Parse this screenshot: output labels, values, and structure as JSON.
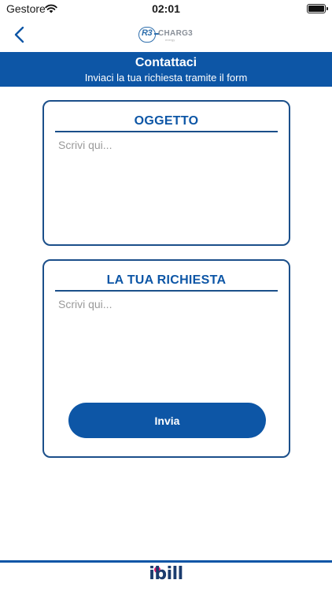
{
  "status_bar": {
    "carrier": "Gestore",
    "time": "02:01"
  },
  "nav": {
    "logo_mark": "R3",
    "logo_word": "CHARG3",
    "logo_sub": "energy"
  },
  "header": {
    "title": "Contattaci",
    "subtitle": "Inviaci la tua richiesta tramite il form"
  },
  "form": {
    "subject": {
      "title": "OGGETTO",
      "placeholder": "Scrivi qui...",
      "value": ""
    },
    "request": {
      "title": "LA TUA RICHIESTA",
      "placeholder": "Scrivi qui...",
      "value": ""
    },
    "send_label": "Invia"
  },
  "footer": {
    "brand": "ibill"
  },
  "colors": {
    "primary": "#0d56a6",
    "border": "#1b4f8a",
    "brand_accent": "#e0186f"
  }
}
